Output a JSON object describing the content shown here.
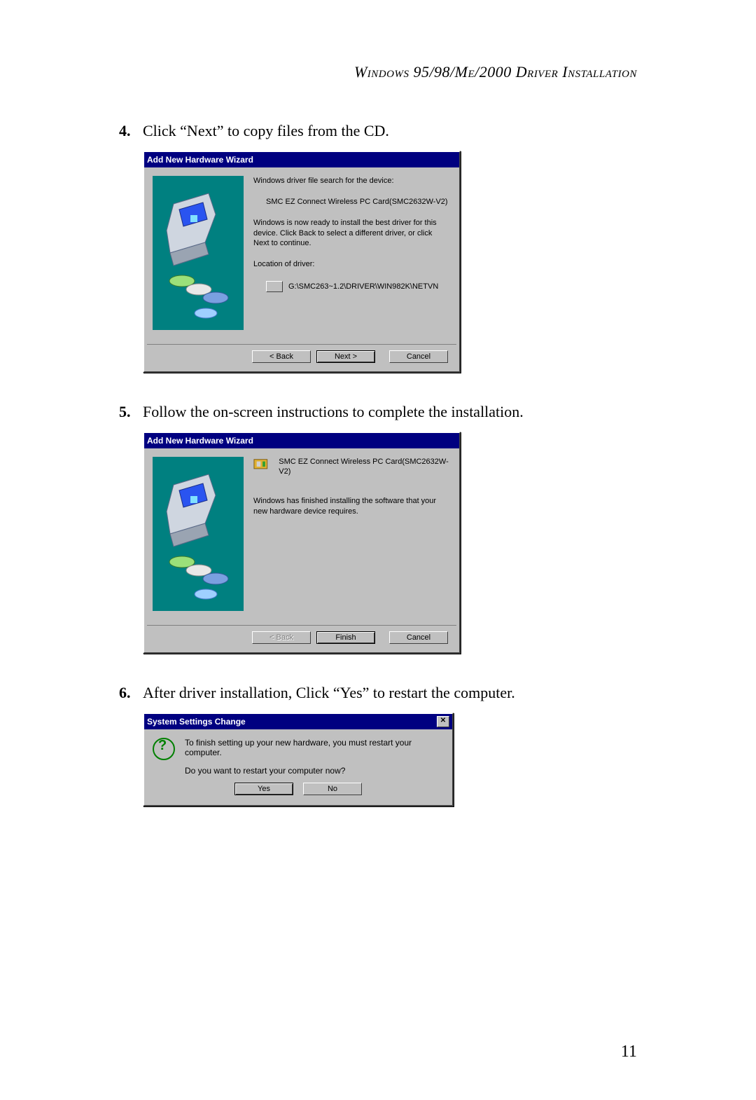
{
  "page_number": "11",
  "header": "Windows 95/98/Me/2000 Driver Installation",
  "steps": {
    "s4": {
      "num": "4.",
      "text": "Click  “Next” to copy files from the CD."
    },
    "s5": {
      "num": "5.",
      "text": "Follow the on-screen instructions to complete the installation."
    },
    "s6": {
      "num": "6.",
      "text": "After driver installation, Click “Yes” to restart the computer."
    }
  },
  "dialog1": {
    "title": "Add New Hardware Wizard",
    "line1": "Windows driver file search for the device:",
    "device": "SMC EZ Connect Wireless PC Card(SMC2632W-V2)",
    "line2": "Windows is now ready to install the best driver for this device. Click Back to select a different driver, or click Next to continue.",
    "loc_label": "Location of driver:",
    "loc_value": "G:\\SMC263~1.2\\DRIVER\\WIN982K\\NETVN",
    "buttons": {
      "back": "< Back",
      "next": "Next >",
      "cancel": "Cancel"
    }
  },
  "dialog2": {
    "title": "Add New Hardware Wizard",
    "device": "SMC EZ Connect Wireless PC Card(SMC2632W-V2)",
    "line1": "Windows has finished installing the software that your new hardware device requires.",
    "buttons": {
      "back": "< Back",
      "finish": "Finish",
      "cancel": "Cancel"
    }
  },
  "dialog3": {
    "title": "System Settings Change",
    "line1": "To finish setting up your new hardware, you must restart your computer.",
    "line2": "Do you want to restart your computer now?",
    "buttons": {
      "yes": "Yes",
      "no": "No"
    }
  }
}
